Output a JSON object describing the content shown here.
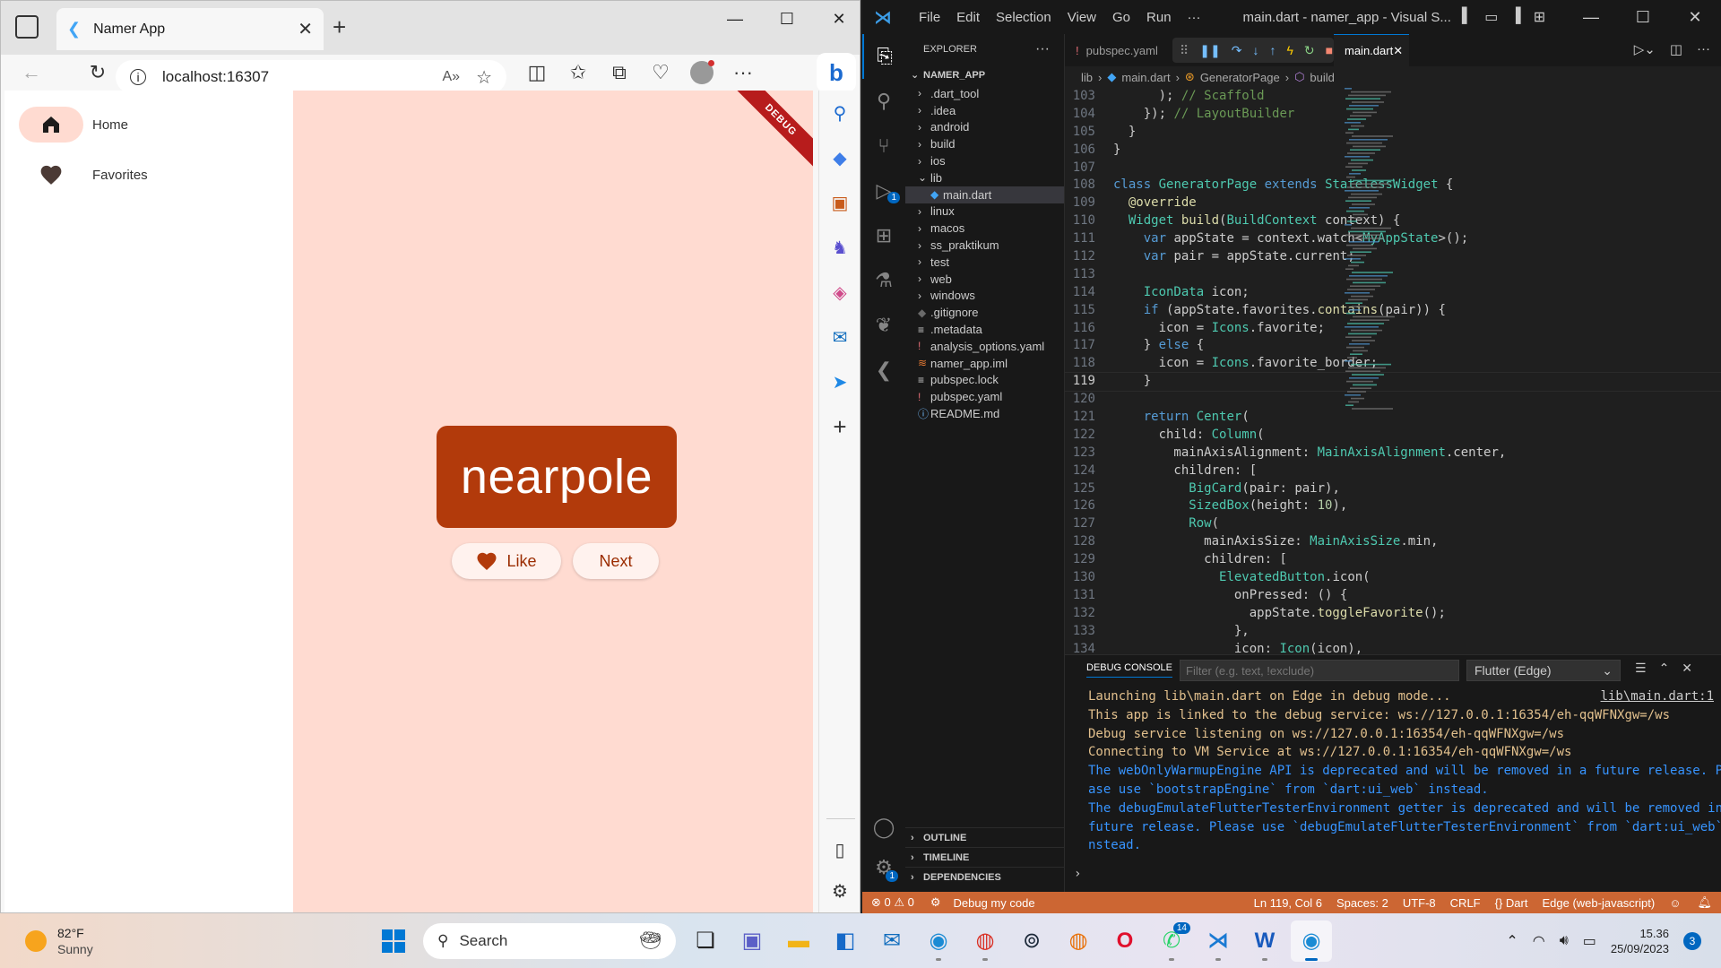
{
  "browser": {
    "tab_title": "Namer App",
    "url": "localhost:16307",
    "sidebar_icons": [
      "search-icon",
      "tag-icon",
      "toolbox-icon",
      "chess-icon",
      "office-icon",
      "outlook-icon",
      "send-icon",
      "plus-icon"
    ]
  },
  "flutter_app": {
    "rail": [
      {
        "label": "Home",
        "icon": "home-icon"
      },
      {
        "label": "Favorites",
        "icon": "heart-icon"
      }
    ],
    "debug_banner": "DEBUG",
    "word_pair": "nearpole",
    "like_label": "Like",
    "next_label": "Next",
    "colors": {
      "card": "#b23a0b",
      "background": "#ffdbd1",
      "accent": "#9b2c00"
    }
  },
  "vscode": {
    "menu": [
      "File",
      "Edit",
      "Selection",
      "View",
      "Go",
      "Run",
      "···"
    ],
    "window_title": "main.dart - namer_app - Visual S...",
    "explorer_title": "EXPLORER",
    "project": "NAMER_APP",
    "tree": [
      {
        "name": ".dart_tool",
        "type": "folder"
      },
      {
        "name": ".idea",
        "type": "folder"
      },
      {
        "name": "android",
        "type": "folder"
      },
      {
        "name": "build",
        "type": "folder"
      },
      {
        "name": "ios",
        "type": "folder"
      },
      {
        "name": "lib",
        "type": "folder-open"
      },
      {
        "name": "main.dart",
        "type": "dart",
        "selected": true
      },
      {
        "name": "linux",
        "type": "folder"
      },
      {
        "name": "macos",
        "type": "folder"
      },
      {
        "name": "ss_praktikum",
        "type": "folder"
      },
      {
        "name": "test",
        "type": "folder"
      },
      {
        "name": "web",
        "type": "folder"
      },
      {
        "name": "windows",
        "type": "folder"
      },
      {
        "name": ".gitignore",
        "type": "git"
      },
      {
        "name": ".metadata",
        "type": "meta"
      },
      {
        "name": "analysis_options.yaml",
        "type": "yaml"
      },
      {
        "name": "namer_app.iml",
        "type": "iml"
      },
      {
        "name": "pubspec.lock",
        "type": "lock"
      },
      {
        "name": "pubspec.yaml",
        "type": "yaml"
      },
      {
        "name": "README.md",
        "type": "info"
      }
    ],
    "bottom_sections": [
      "OUTLINE",
      "TIMELINE",
      "DEPENDENCIES"
    ],
    "tabs": [
      {
        "label": "pubspec.yaml",
        "active": false
      },
      {
        "label": "main.dart",
        "active": true
      }
    ],
    "breadcrumb": [
      "lib",
      "main.dart",
      "GeneratorPage",
      "build"
    ],
    "code": [
      {
        "n": "103",
        "t": "      ); // Scaffold"
      },
      {
        "n": "104",
        "t": "    }); // LayoutBuilder"
      },
      {
        "n": "105",
        "t": "  }"
      },
      {
        "n": "106",
        "t": "}"
      },
      {
        "n": "107",
        "t": ""
      },
      {
        "n": "108",
        "t": "class GeneratorPage extends StatelessWidget {"
      },
      {
        "n": "109",
        "t": "  @override"
      },
      {
        "n": "110",
        "t": "  Widget build(BuildContext context) {"
      },
      {
        "n": "111",
        "t": "    var appState = context.watch<MyAppState>();"
      },
      {
        "n": "112",
        "t": "    var pair = appState.current;"
      },
      {
        "n": "113",
        "t": ""
      },
      {
        "n": "114",
        "t": "    IconData icon;"
      },
      {
        "n": "115",
        "t": "    if (appState.favorites.contains(pair)) {"
      },
      {
        "n": "116",
        "t": "      icon = Icons.favorite;"
      },
      {
        "n": "117",
        "t": "    } else {"
      },
      {
        "n": "118",
        "t": "      icon = Icons.favorite_border;"
      },
      {
        "n": "119",
        "t": "    }"
      },
      {
        "n": "120",
        "t": ""
      },
      {
        "n": "121",
        "t": "    return Center("
      },
      {
        "n": "122",
        "t": "      child: Column("
      },
      {
        "n": "123",
        "t": "        mainAxisAlignment: MainAxisAlignment.center,"
      },
      {
        "n": "124",
        "t": "        children: ["
      },
      {
        "n": "125",
        "t": "          BigCard(pair: pair),"
      },
      {
        "n": "126",
        "t": "          SizedBox(height: 10),"
      },
      {
        "n": "127",
        "t": "          Row("
      },
      {
        "n": "128",
        "t": "            mainAxisSize: MainAxisSize.min,"
      },
      {
        "n": "129",
        "t": "            children: ["
      },
      {
        "n": "130",
        "t": "              ElevatedButton.icon("
      },
      {
        "n": "131",
        "t": "                onPressed: () {"
      },
      {
        "n": "132",
        "t": "                  appState.toggleFavorite();"
      },
      {
        "n": "133",
        "t": "                },"
      },
      {
        "n": "134",
        "t": "                icon: Icon(icon),"
      }
    ],
    "panel": {
      "tab": "DEBUG CONSOLE",
      "filter_placeholder": "Filter (e.g. text, !exclude)",
      "target": "Flutter (Edge)",
      "source_link": "lib\\main.dart:1",
      "lines": [
        {
          "t": "Launching lib\\main.dart on Edge in debug mode...",
          "c": "yellow"
        },
        {
          "t": "This app is linked to the debug service: ws://127.0.0.1:16354/eh-qqWFNXgw=/ws",
          "c": "yellow"
        },
        {
          "t": "Debug service listening on ws://127.0.0.1:16354/eh-qqWFNXgw=/ws",
          "c": "yellow"
        },
        {
          "t": "Connecting to VM Service at ws://127.0.0.1:16354/eh-qqWFNXgw=/ws",
          "c": "yellow"
        },
        {
          "t": "The webOnlyWarmupEngine API is deprecated and will be removed in a future release. Ple",
          "c": "blue"
        },
        {
          "t": "ase use `bootstrapEngine` from `dart:ui_web` instead.",
          "c": "blue"
        },
        {
          "t": "The debugEmulateFlutterTesterEnvironment getter is deprecated and will be removed in a",
          "c": "blue"
        },
        {
          "t": "future release. Please use `debugEmulateFlutterTesterEnvironment` from `dart:ui_web` i",
          "c": "blue"
        },
        {
          "t": "nstead.",
          "c": "blue"
        }
      ]
    },
    "status": {
      "problems": "⊗ 0 ⚠ 0",
      "debug": "Debug my code",
      "position": "Ln 119, Col 6",
      "spaces": "Spaces: 2",
      "encoding": "UTF-8",
      "eol": "CRLF",
      "language": "{} Dart",
      "device": "Edge (web-javascript)"
    }
  },
  "taskbar": {
    "weather_temp": "82°F",
    "weather_desc": "Sunny",
    "search_label": "Search",
    "whatsapp_badge": "14",
    "time": "15.36",
    "date": "25/09/2023",
    "notification_count": "3"
  }
}
